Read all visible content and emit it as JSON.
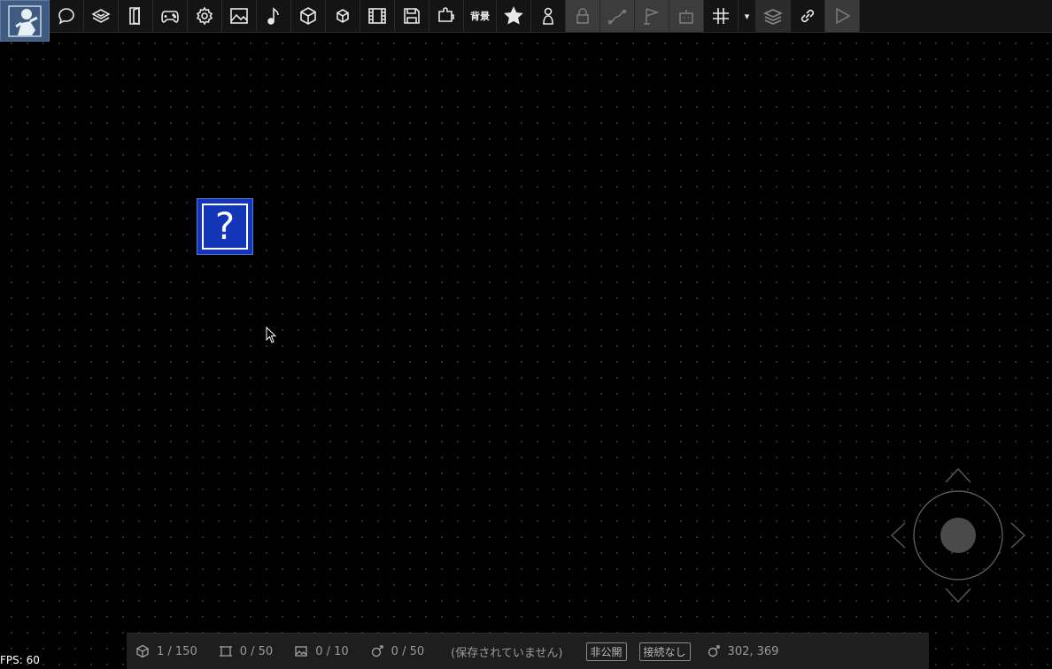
{
  "toolbar": {
    "bg_label": "背景",
    "dropdown_glyph": "▾",
    "buttons": [
      "speech-icon",
      "stage-icon",
      "door-icon",
      "gamepad-icon",
      "gear-icon",
      "image-icon",
      "music-icon",
      "cube-icon",
      "small-cube-icon",
      "film-icon",
      "save-icon",
      "puzzle-icon",
      "background-text",
      "star-icon",
      "person-icon",
      "lock-icon",
      "path-icon",
      "flag-icon",
      "robot-icon",
      "grid-icon",
      "dropdown-icon",
      "layers-icon",
      "link-icon",
      "play-icon"
    ]
  },
  "canvas": {
    "block_glyph": "?",
    "block_color": "#1335b8"
  },
  "statusbar": {
    "objects": "1 / 150",
    "frames": "0 / 50",
    "images": "0 / 10",
    "motions": "0 / 50",
    "save_status": "(保存されていません)",
    "visibility": "非公開",
    "connection": "接続なし",
    "coords": "302, 369"
  },
  "fps": "FPS: 60"
}
